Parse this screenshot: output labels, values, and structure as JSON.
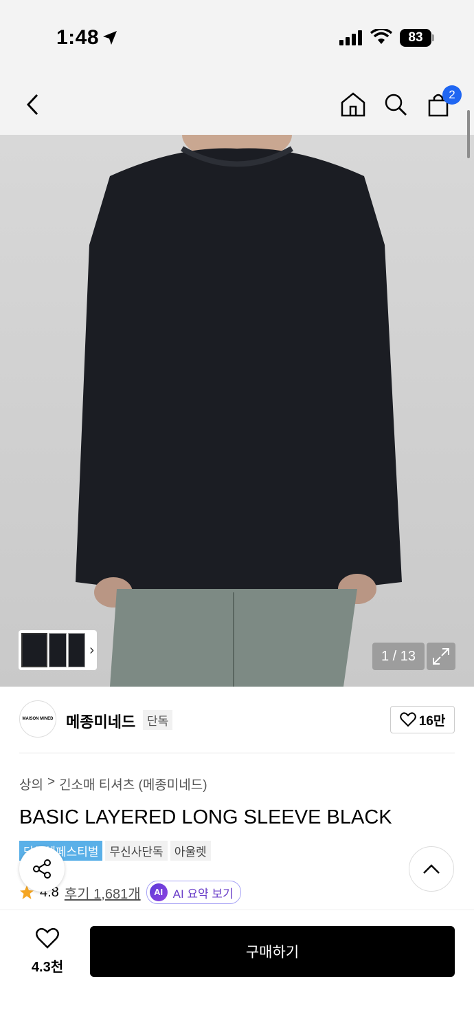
{
  "status_bar": {
    "time": "1:48",
    "battery": "83"
  },
  "nav": {
    "cart_count": "2"
  },
  "gallery": {
    "counter": "1 / 13"
  },
  "brand": {
    "logo_text": "MAISON MINED",
    "name": "메종미네드",
    "tag": "단독",
    "likes": "16만"
  },
  "breadcrumb": {
    "category": "상의",
    "separator": ">",
    "subcategory": "긴소매 티셔츠 (메종미네드)"
  },
  "product": {
    "title": "BASIC LAYERED LONG SLEEVE BLACK",
    "tags": [
      "단독혜페스티벌",
      "무신사단독",
      "아울렛"
    ],
    "rating": "4.8",
    "reviews": "후기 1,681개",
    "ai_summary": "AI 요약 보기",
    "ai_icon": "AI"
  },
  "bottom": {
    "wish_count": "4.3천",
    "buy_label": "구매하기"
  },
  "colors": {
    "accent_blue": "#1f66f2",
    "tag_blue": "#5ab0e8",
    "ai_purple": "#6b3fc9"
  }
}
